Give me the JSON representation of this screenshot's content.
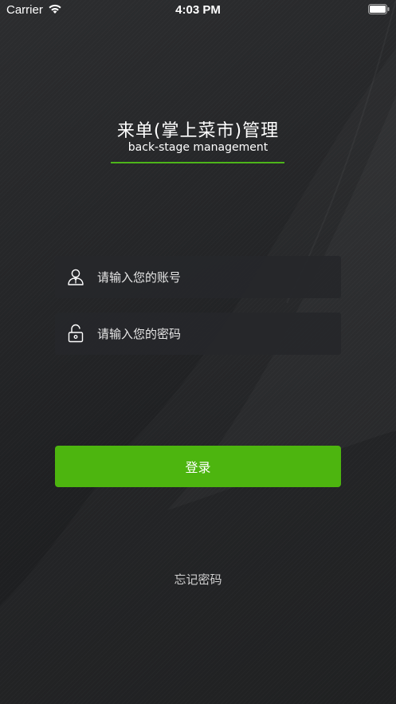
{
  "status_bar": {
    "carrier": "Carrier",
    "time": "4:03 PM",
    "wifi_icon": "wifi-icon",
    "battery_icon": "battery-icon"
  },
  "header": {
    "title": "来单(掌上菜市)管理",
    "subtitle": "back-stage management",
    "accent_color": "#4db51a"
  },
  "form": {
    "username": {
      "placeholder": "请输入您的账号",
      "value": "",
      "icon": "user-icon"
    },
    "password": {
      "placeholder": "请输入您的密码",
      "value": "",
      "icon": "lock-icon"
    },
    "login_label": "登录",
    "login_color": "#4db50f",
    "forgot_label": "忘记密码"
  }
}
